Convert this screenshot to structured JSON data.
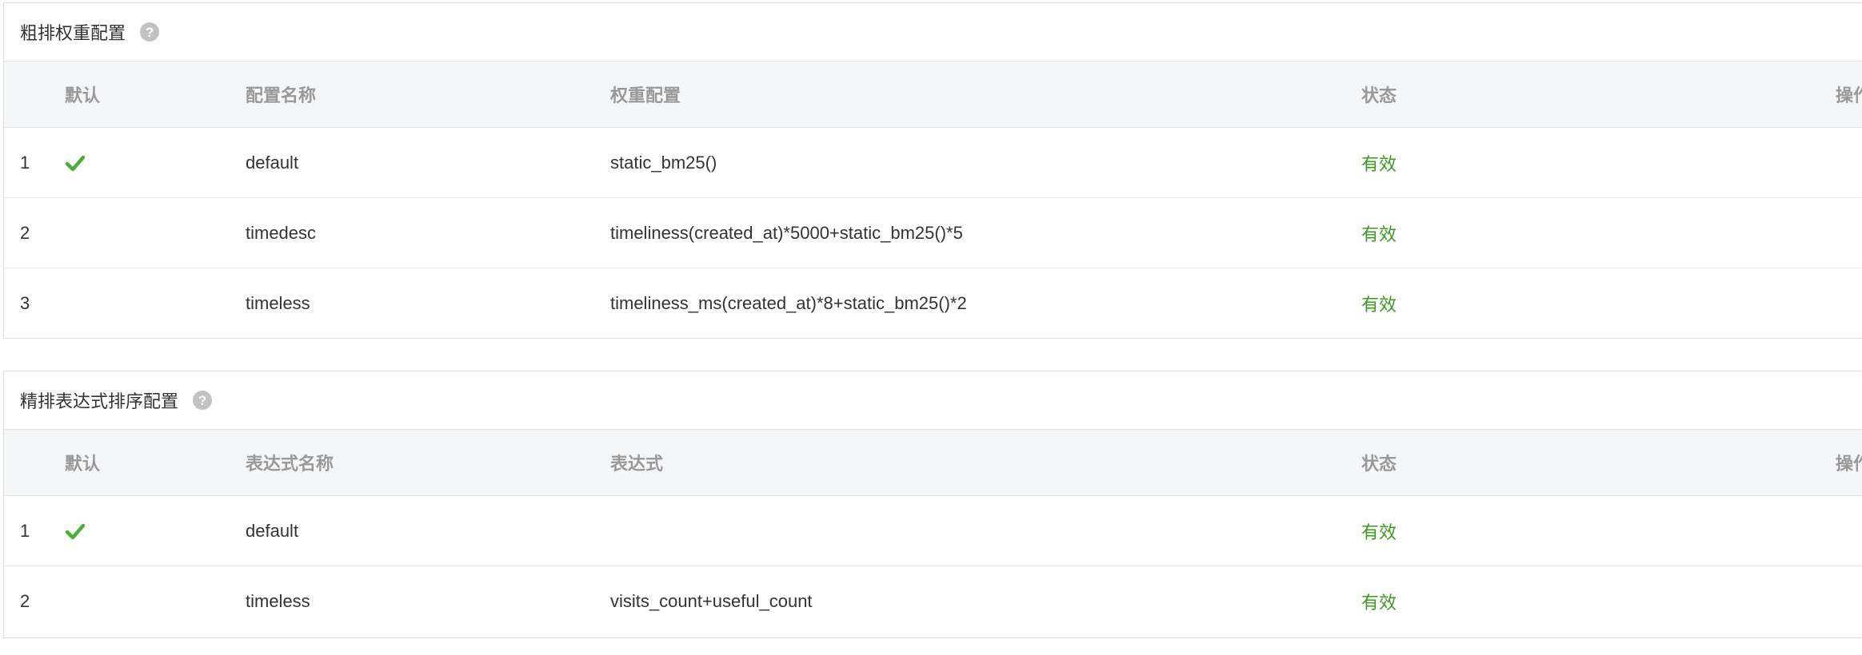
{
  "coarse": {
    "title": "粗排权重配置",
    "help_icon": "question-circle-icon",
    "columns": {
      "default": "默认",
      "name": "配置名称",
      "expr": "权重配置",
      "state": "状态",
      "op": "操作"
    },
    "rows": [
      {
        "index": "1",
        "is_default": true,
        "name": "default",
        "expr": "static_bm25()",
        "state": "有效"
      },
      {
        "index": "2",
        "is_default": false,
        "name": "timedesc",
        "expr": "timeliness(created_at)*5000+static_bm25()*5",
        "state": "有效"
      },
      {
        "index": "3",
        "is_default": false,
        "name": "timeless",
        "expr": "timeliness_ms(created_at)*8+static_bm25()*2",
        "state": "有效"
      }
    ]
  },
  "fine": {
    "title": "精排表达式排序配置",
    "help_icon": "question-circle-icon",
    "columns": {
      "default": "默认",
      "name": "表达式名称",
      "expr": "表达式",
      "state": "状态",
      "op": "操作"
    },
    "rows": [
      {
        "index": "1",
        "is_default": true,
        "name": "default",
        "expr": "",
        "state": "有效"
      },
      {
        "index": "2",
        "is_default": false,
        "name": "timeless",
        "expr": "visits_count+useful_count",
        "state": "有效"
      }
    ]
  },
  "colors": {
    "status_valid": "#3a9a22",
    "check": "#4caf3a",
    "header_bg": "#f5f6f8",
    "header_text": "#999999"
  }
}
